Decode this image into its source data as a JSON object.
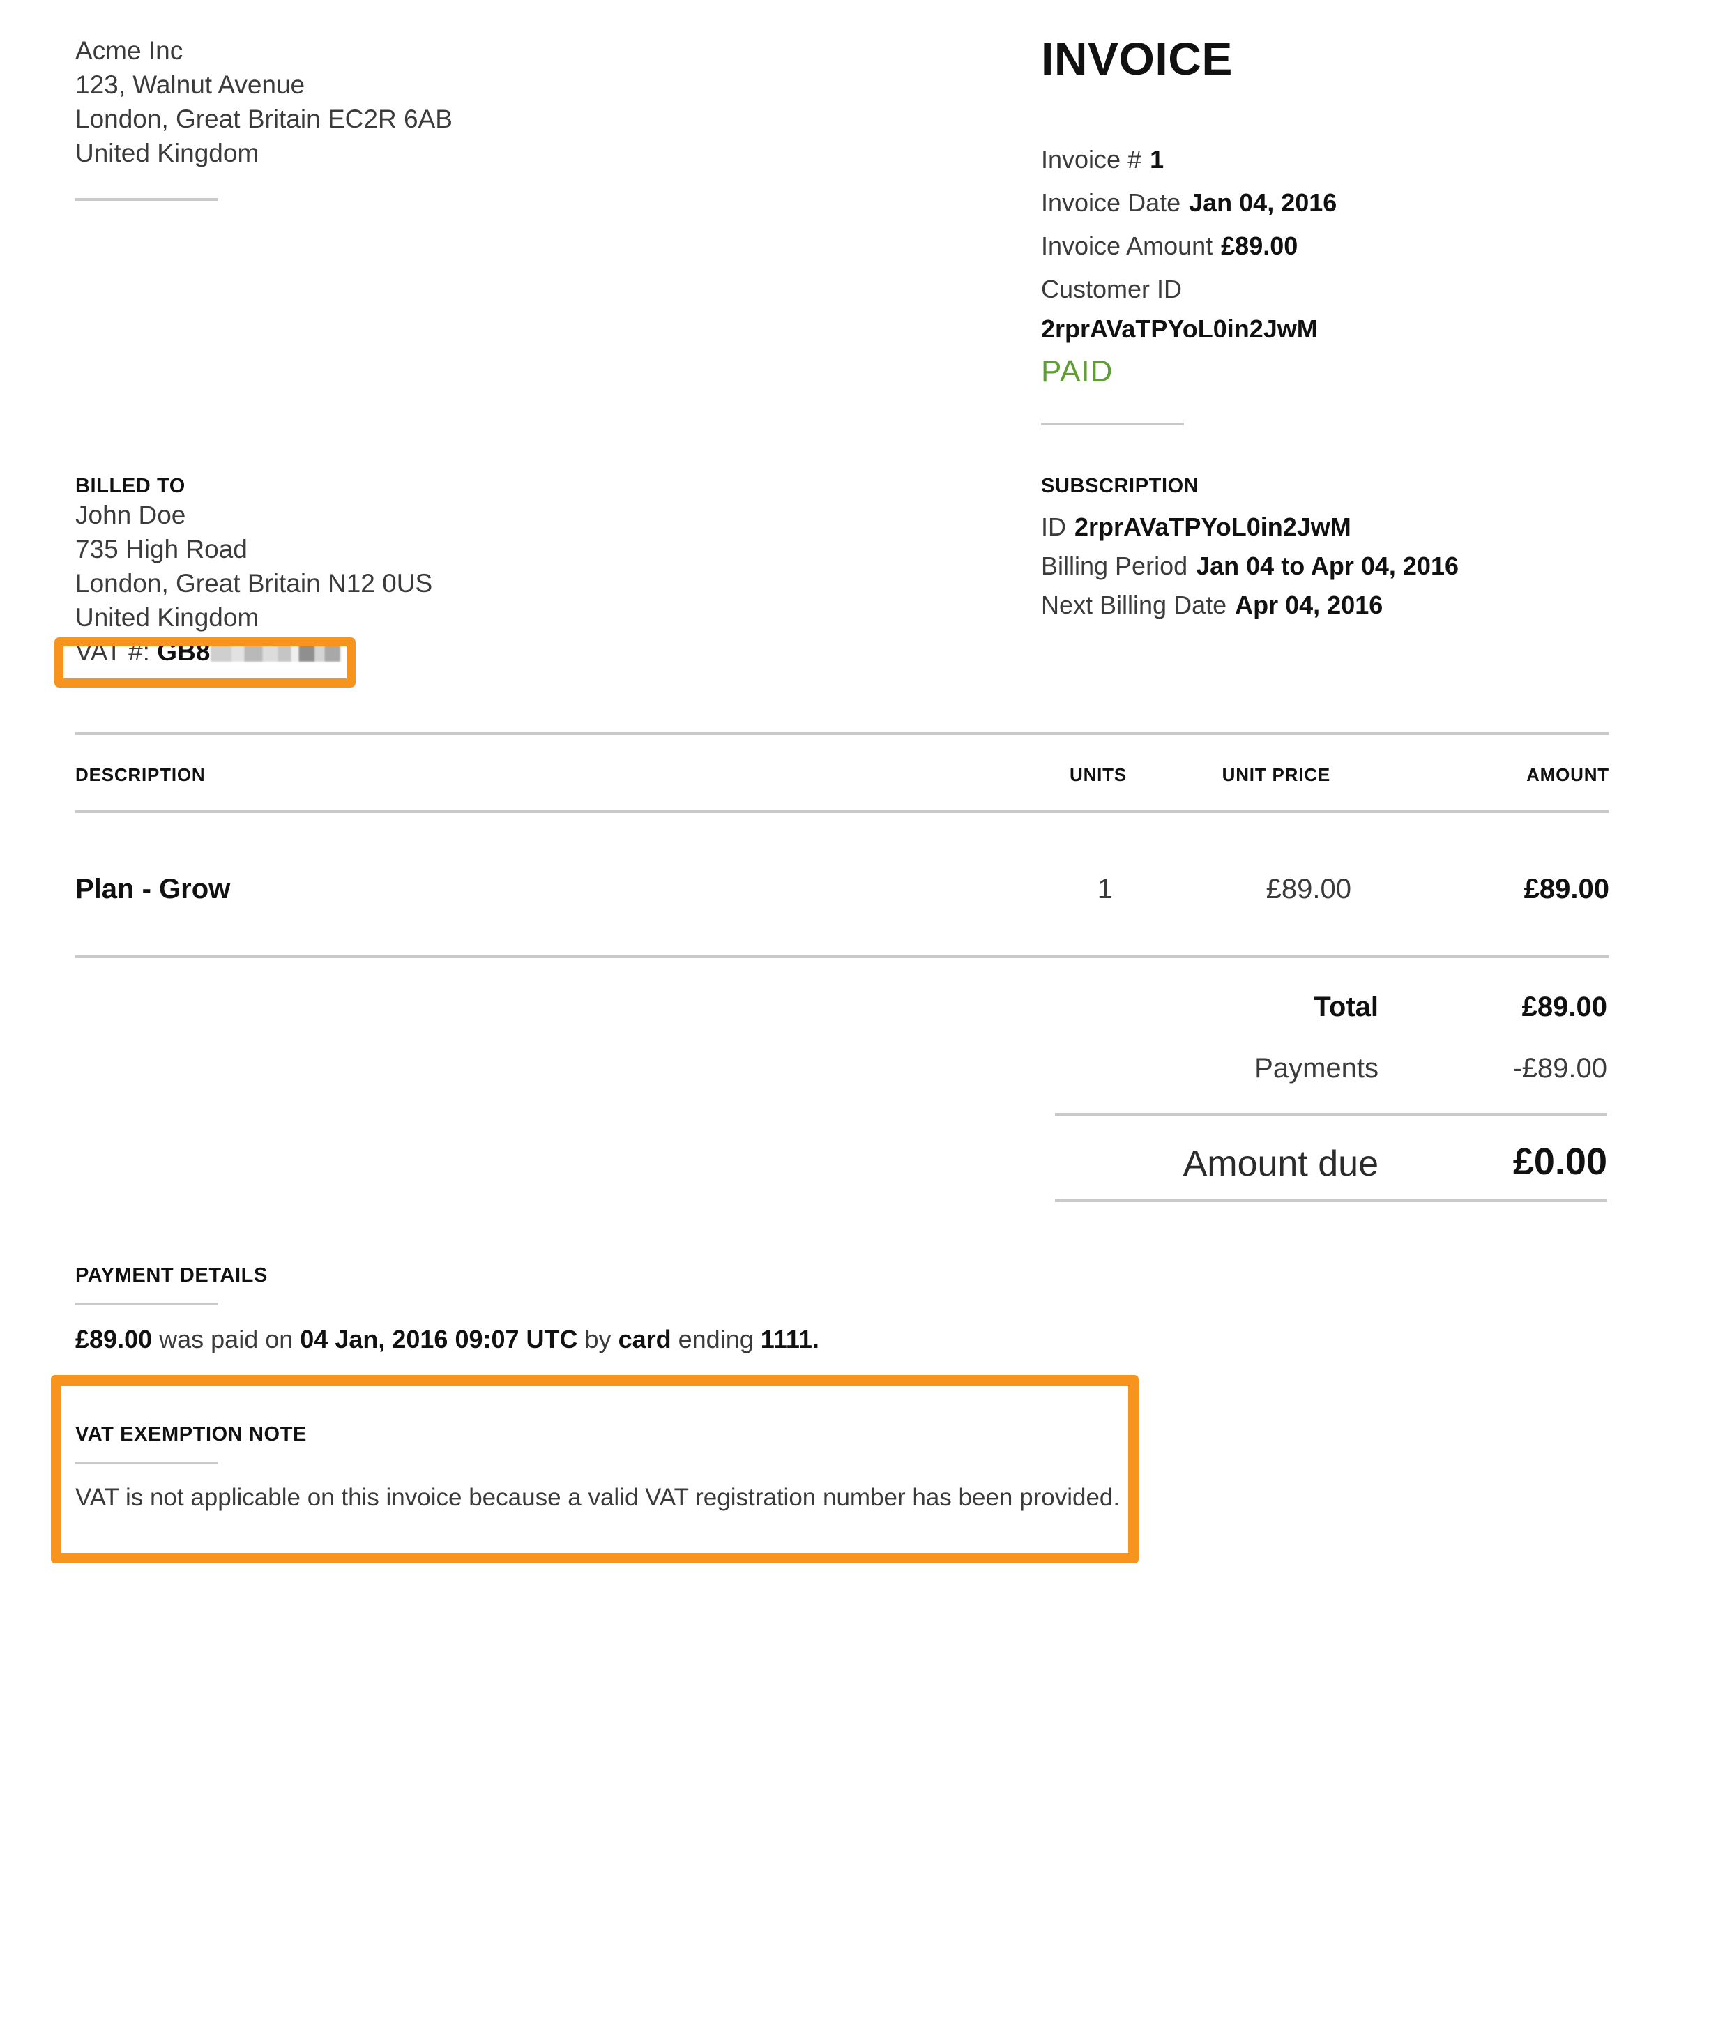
{
  "colors": {
    "accent_orange": "#f7941e",
    "paid_green": "#5f9e33",
    "rule_gray": "#c9c9c9",
    "text_dark": "#111111",
    "text_body": "#3b3b3b"
  },
  "sender": {
    "name": "Acme Inc",
    "street": "123, Walnut Avenue",
    "city_line": "London, Great Britain EC2R 6AB",
    "country": "United Kingdom"
  },
  "invoice": {
    "title": "INVOICE",
    "number_label": "Invoice #",
    "number_value": "1",
    "date_label": "Invoice Date",
    "date_value": "Jan 04, 2016",
    "amount_label": "Invoice Amount",
    "amount_value": "£89.00",
    "customer_id_label": "Customer ID",
    "customer_id_value": "2rprAVaTPYoL0in2JwM",
    "status": "PAID"
  },
  "billed_to": {
    "heading": "BILLED TO",
    "name": "John Doe",
    "street": "735 High Road",
    "city_line": "London, Great Britain N12 0US",
    "country": "United Kingdom",
    "vat_label": "VAT #:",
    "vat_value": "GB8"
  },
  "subscription": {
    "heading": "SUBSCRIPTION",
    "id_label": "ID",
    "id_value": "2rprAVaTPYoL0in2JwM",
    "billing_period_label": "Billing Period",
    "billing_period_value": "Jan 04 to Apr 04, 2016",
    "next_billing_label": "Next Billing Date",
    "next_billing_value": "Apr 04, 2016"
  },
  "table": {
    "columns": [
      "DESCRIPTION",
      "UNITS",
      "UNIT PRICE",
      "AMOUNT"
    ],
    "rows": [
      {
        "description": "Plan - Grow",
        "units": "1",
        "unit_price": "£89.00",
        "amount": "£89.00"
      }
    ]
  },
  "totals": {
    "total_label": "Total",
    "total_value": "£89.00",
    "payments_label": "Payments",
    "payments_value": "-£89.00",
    "due_label": "Amount due",
    "due_value": "£0.00"
  },
  "payment_details": {
    "heading": "PAYMENT DETAILS",
    "amount": "£89.00",
    "text_1": "was paid on",
    "datetime": "04 Jan, 2016 09:07 UTC",
    "text_2": "by",
    "method": "card",
    "text_3": "ending",
    "last4": "1111."
  },
  "vat_note": {
    "heading": "VAT EXEMPTION NOTE",
    "body": "VAT is not applicable on this invoice because a valid VAT registration number has been provided."
  }
}
